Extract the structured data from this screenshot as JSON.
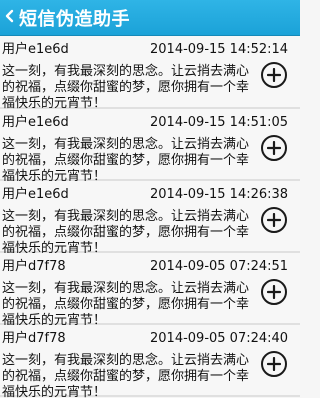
{
  "header": {
    "back_icon": "chevron-left-icon",
    "title": "短信伪造助手"
  },
  "messages": [
    {
      "user": "用户e1e6d",
      "time": "2014-09-15 14:52:14",
      "text": "这一刻，有我最深刻的思念。让云捎去满心的祝福，点缀你甜蜜的梦，愿你拥有一个幸福快乐的元宵节！"
    },
    {
      "user": "用户e1e6d",
      "time": "2014-09-15 14:51:05",
      "text": "这一刻，有我最深刻的思念。让云捎去满心的祝福，点缀你甜蜜的梦，愿你拥有一个幸福快乐的元宵节！"
    },
    {
      "user": "用户e1e6d",
      "time": "2014-09-15 14:26:38",
      "text": "这一刻，有我最深刻的思念。让云捎去满心的祝福，点缀你甜蜜的梦，愿你拥有一个幸福快乐的元宵节！"
    },
    {
      "user": "用户d7f78",
      "time": "2014-09-05 07:24:51",
      "text": "这一刻，有我最深刻的思念。让云捎去满心的祝福，点缀你甜蜜的梦，愿你拥有一个幸福快乐的元宵节！"
    },
    {
      "user": "用户d7f78",
      "time": "2014-09-05 07:24:40",
      "text": "这一刻，有我最深刻的思念。让云捎去满心的祝福，点缀你甜蜜的梦，愿你拥有一个幸福快乐的元宵节！"
    }
  ],
  "colors": {
    "titlebar": "#1ba2d8",
    "background": "#f7f7f7",
    "divider": "#e0e0e0"
  }
}
